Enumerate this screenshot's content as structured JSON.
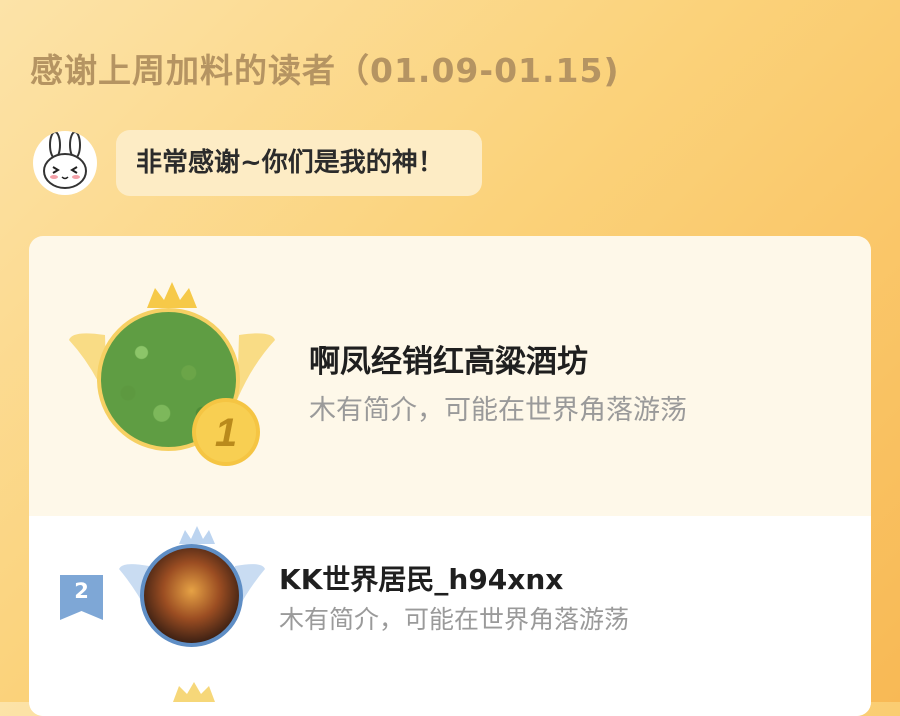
{
  "header": {
    "title": "感谢上周加料的读者（01.09-01.15)"
  },
  "message": {
    "mascot_icon": "rabbit-icon",
    "text": "非常感谢~你们是我的神！"
  },
  "readers": [
    {
      "rank": "1",
      "name": "啊凤经销红高粱酒坊",
      "bio": "木有简介，可能在世界角落游荡",
      "badge_color": "#f5c543",
      "crown_color": "#f6c948"
    },
    {
      "rank": "2",
      "name": "KK世界居民_h94xnx",
      "bio": "木有简介，可能在世界角落游荡",
      "badge_color": "#7ea7d6",
      "crown_color": "#bcd4f0"
    }
  ]
}
